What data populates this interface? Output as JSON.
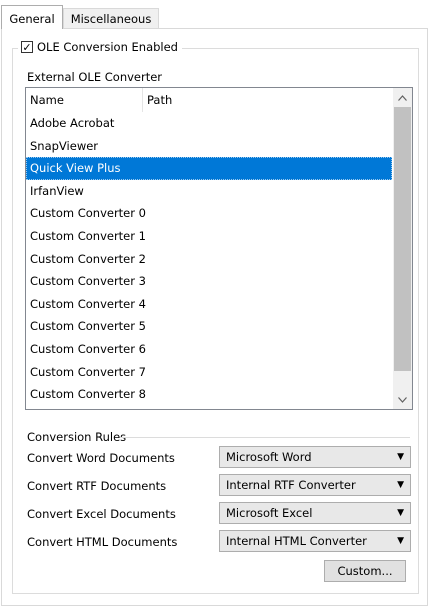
{
  "tabs": [
    {
      "label": "General",
      "active": true
    },
    {
      "label": "Miscellaneous",
      "active": false
    }
  ],
  "ole": {
    "checkbox_label": "OLE Conversion Enabled",
    "checked": true,
    "external_label": "External OLE Converter"
  },
  "list": {
    "columns": [
      "Name",
      "Path"
    ],
    "rows": [
      "Adobe Acrobat",
      "SnapViewer",
      "Quick View Plus",
      "IrfanView",
      "Custom Converter 0",
      "Custom Converter 1",
      "Custom Converter 2",
      "Custom Converter 3",
      "Custom Converter 4",
      "Custom Converter 5",
      "Custom Converter 6",
      "Custom Converter 7",
      "Custom Converter 8"
    ],
    "selected": "Quick View Plus"
  },
  "rules": {
    "title": "Conversion Rules",
    "items": [
      {
        "label": "Convert Word Documents",
        "value": "Microsoft Word"
      },
      {
        "label": "Convert RTF Documents",
        "value": "Internal RTF Converter"
      },
      {
        "label": "Convert Excel Documents",
        "value": "Microsoft Excel"
      },
      {
        "label": "Convert HTML Documents",
        "value": "Internal HTML Converter"
      }
    ],
    "custom_button": "Custom..."
  },
  "icons": {
    "checkbox": "checkmark-icon",
    "scroll_up": "chevron-up-icon",
    "scroll_down": "chevron-down-icon",
    "dropdown": "dropdown-arrow-icon"
  },
  "colors": {
    "selection": "#0078d7"
  }
}
